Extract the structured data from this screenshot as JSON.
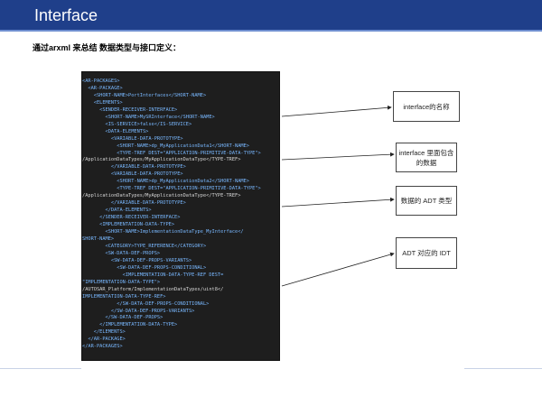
{
  "header": {
    "title": "Interface"
  },
  "subtitle": "通过arxml 来总结 数据类型与接口定义：",
  "code": [
    {
      "t": "<AR-PACKAGES>",
      "c": "c1"
    },
    {
      "t": "  <AR-PACKAGE>",
      "c": "c1"
    },
    {
      "t": "    <SHORT-NAME>PortInterfaces</SHORT-NAME>",
      "c": "c1"
    },
    {
      "t": "    <ELEMENTS>",
      "c": "c1"
    },
    {
      "t": "      <SENDER-RECEIVER-INTERFACE>",
      "c": "c1"
    },
    {
      "t": "        <SHORT-NAME>MySRInterface</SHORT-NAME>",
      "c": "c1"
    },
    {
      "t": "        <IS-SERVICE>false</IS-SERVICE>",
      "c": "c1"
    },
    {
      "t": "        <DATA-ELEMENTS>",
      "c": "c1"
    },
    {
      "t": "          <VARIABLE-DATA-PROTOTYPE>",
      "c": "c1"
    },
    {
      "t": "            <SHORT-NAME>dp_MyApplicationData1</SHORT-NAME>",
      "c": "c1"
    },
    {
      "t": "            <TYPE-TREF DEST=\"APPLICATION-PRIMITIVE-DATA-TYPE\">",
      "c": "c1"
    },
    {
      "t": "/ApplicationDataTypes/MyApplicationDataType</TYPE-TREF>",
      "c": "c0"
    },
    {
      "t": "          </VARIABLE-DATA-PROTOTYPE>",
      "c": "c1"
    },
    {
      "t": "          <VARIABLE-DATA-PROTOTYPE>",
      "c": "c1"
    },
    {
      "t": "            <SHORT-NAME>dp_MyApplicationData2</SHORT-NAME>",
      "c": "c1"
    },
    {
      "t": "            <TYPE-TREF DEST=\"APPLICATION-PRIMITIVE-DATA-TYPE\">",
      "c": "c1"
    },
    {
      "t": "/ApplicationDataTypes/MyApplicationDataType</TYPE-TREF>",
      "c": "c0"
    },
    {
      "t": "          </VARIABLE-DATA-PROTOTYPE>",
      "c": "c1"
    },
    {
      "t": "        </DATA-ELEMENTS>",
      "c": "c1"
    },
    {
      "t": "      </SENDER-RECEIVER-INTERFACE>",
      "c": "c1"
    },
    {
      "t": "      <IMPLEMENTATION-DATA-TYPE>",
      "c": "c1"
    },
    {
      "t": "        <SHORT-NAME>ImplementationDataType_MyInterface</",
      "c": "c1"
    },
    {
      "t": "SHORT-NAME>",
      "c": "c1"
    },
    {
      "t": "        <CATEGORY>TYPE_REFERENCE</CATEGORY>",
      "c": "c1"
    },
    {
      "t": "        <SW-DATA-DEF-PROPS>",
      "c": "c1"
    },
    {
      "t": "          <SW-DATA-DEF-PROPS-VARIANTS>",
      "c": "c1"
    },
    {
      "t": "            <SW-DATA-DEF-PROPS-CONDITIONAL>",
      "c": "c1"
    },
    {
      "t": "              <IMPLEMENTATION-DATA-TYPE-REF DEST=",
      "c": "c1"
    },
    {
      "t": "\"IMPLEMENTATION-DATA-TYPE\">",
      "c": "c1"
    },
    {
      "t": "/AUTOSAR_Platform/ImplementationDataTypes/uint8</",
      "c": "c0"
    },
    {
      "t": "IMPLEMENTATION-DATA-TYPE-REF>",
      "c": "c1"
    },
    {
      "t": "            </SW-DATA-DEF-PROPS-CONDITIONAL>",
      "c": "c1"
    },
    {
      "t": "          </SW-DATA-DEF-PROPS-VARIANTS>",
      "c": "c1"
    },
    {
      "t": "        </SW-DATA-DEF-PROPS>",
      "c": "c1"
    },
    {
      "t": "      </IMPLEMENTATION-DATA-TYPE>",
      "c": "c1"
    },
    {
      "t": "    </ELEMENTS>",
      "c": "c1"
    },
    {
      "t": "  </AR-PACKAGE>",
      "c": "c1"
    },
    {
      "t": "</AR-PACKAGES>",
      "c": "c1"
    }
  ],
  "callouts": {
    "c1": "interface的名称",
    "c2": "interface 里面包含的数据",
    "c3": "数据的 ADT 类型",
    "c4": "ADT 对应的 IDT"
  }
}
